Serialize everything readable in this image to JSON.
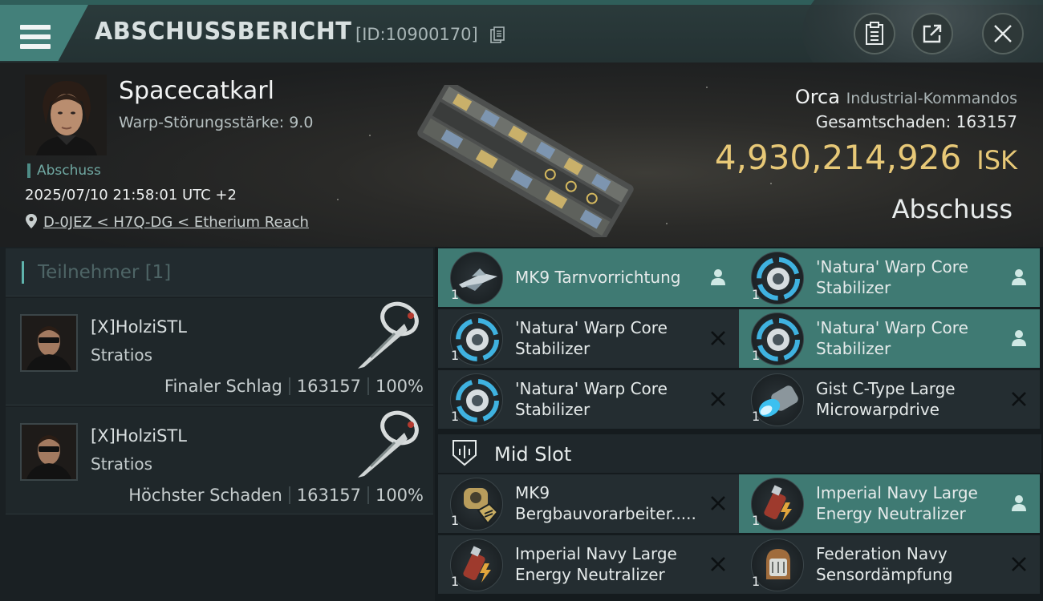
{
  "header": {
    "title": "ABSCHUSSBERICHT",
    "report_id": "[ID:10900170]"
  },
  "victim": {
    "name": "Spacecatkarl",
    "warp_strength": "Warp-Störungsstärke: 9.0",
    "tag": "Abschuss",
    "datetime": "2025/07/10 21:58:01 UTC +2",
    "location": "D-0JEZ < H7Q-DG < Etherium Reach",
    "ship": "Orca",
    "ship_class": "Industrial-Kommandos",
    "total_damage_label": "Gesamtschaden:",
    "total_damage": "163157",
    "isk_value": "4,930,214,926",
    "isk_unit": "ISK",
    "result": "Abschuss"
  },
  "participants": {
    "title": "Teilnehmer",
    "count": "[1]",
    "items": [
      {
        "name": "[X]HolziSTL",
        "ship": "Stratios",
        "role": "Finaler Schlag",
        "damage": "163157",
        "percent": "100%"
      },
      {
        "name": "[X]HolziSTL",
        "ship": "Stratios",
        "role": "Höchster Schaden",
        "damage": "163157",
        "percent": "100%"
      }
    ]
  },
  "modules": {
    "items": [
      {
        "name": "MK9 Tarnvorrichtung",
        "qty": "1",
        "icon": "cloak-icon",
        "highlight": true,
        "mark": "pilot-icon"
      },
      {
        "name": "'Natura' Warp Core Stabilizer",
        "qty": "1",
        "icon": "warp-core-stabilizer-icon",
        "highlight": true,
        "mark": "pilot-icon"
      },
      {
        "name": "'Natura' Warp Core Stabilizer",
        "qty": "1",
        "icon": "warp-core-stabilizer-icon",
        "highlight": false,
        "mark": "destroyed-icon"
      },
      {
        "name": "'Natura' Warp Core Stabilizer",
        "qty": "1",
        "icon": "warp-core-stabilizer-icon",
        "highlight": true,
        "mark": "pilot-icon"
      },
      {
        "name": "'Natura' Warp Core Stabilizer",
        "qty": "1",
        "icon": "warp-core-stabilizer-icon",
        "highlight": false,
        "mark": "destroyed-icon"
      },
      {
        "name": "Gist C-Type Large Microwarpdrive",
        "qty": "1",
        "icon": "microwarpdrive-icon",
        "highlight": false,
        "mark": "destroyed-icon"
      }
    ],
    "mid_section": "Mid Slot",
    "mid_items": [
      {
        "name": "MK9 Bergbauvorarbeiter.....",
        "qty": "1",
        "icon": "mining-foreman-icon",
        "highlight": false,
        "mark": "destroyed-icon"
      },
      {
        "name": "Imperial Navy Large Energy Neutralizer",
        "qty": "1",
        "icon": "energy-neutralizer-icon",
        "highlight": true,
        "mark": "pilot-icon"
      },
      {
        "name": "Imperial Navy Large Energy Neutralizer",
        "qty": "1",
        "icon": "energy-neutralizer-icon",
        "highlight": false,
        "mark": "destroyed-icon"
      },
      {
        "name": "Federation Navy Sensordämpfung",
        "qty": "1",
        "icon": "sensor-dampener-icon",
        "highlight": false,
        "mark": "destroyed-icon"
      }
    ]
  },
  "colors": {
    "accent": "#43807a",
    "highlight_row": "#3f7a73",
    "isk": "#e7c877"
  }
}
